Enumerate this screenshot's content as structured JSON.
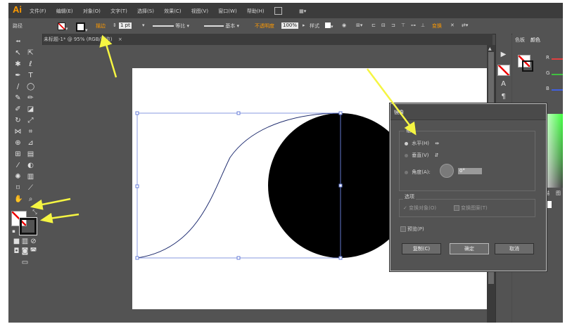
{
  "app": {
    "logo": "Ai",
    "menus": [
      "文件(F)",
      "编辑(E)",
      "对象(O)",
      "文字(T)",
      "选择(S)",
      "效果(C)",
      "视图(V)",
      "窗口(W)",
      "帮助(H)"
    ]
  },
  "control_bar": {
    "mode_label": "路径",
    "stroke_label": "描边",
    "stroke_width": "1 pt",
    "stroke_profile": "等比",
    "brush": "基本",
    "opacity_label": "不透明度",
    "opacity_value": "100%",
    "style_label": "样式",
    "transform_label": "变换"
  },
  "document_tab": {
    "title": "未标题-1* @ 95% (RGB/预览)",
    "close": "×"
  },
  "panels": {
    "color_tabs": [
      "色板",
      "颜色"
    ],
    "channels": [
      "R",
      "G",
      "B"
    ],
    "lower_tabs": [
      "描",
      "图"
    ]
  },
  "dialog": {
    "title": "镜像",
    "axis_group": "轴",
    "horizontal": "水平(H)",
    "vertical": "垂直(V)",
    "angle_label": "角度(A):",
    "angle_value": "0°",
    "options_group": "选项",
    "transform_objects": "✓ 变换对象(O)",
    "transform_patterns": "变换图案(T)",
    "preview": "预览(P)",
    "copy_button": "复制(C)",
    "ok_button": "确定",
    "cancel_button": "取消"
  },
  "colors": {
    "accent": "#ff9a00",
    "arrow": "#f5f542",
    "ui_bg": "#535353",
    "selection": "#6a7fd8"
  }
}
